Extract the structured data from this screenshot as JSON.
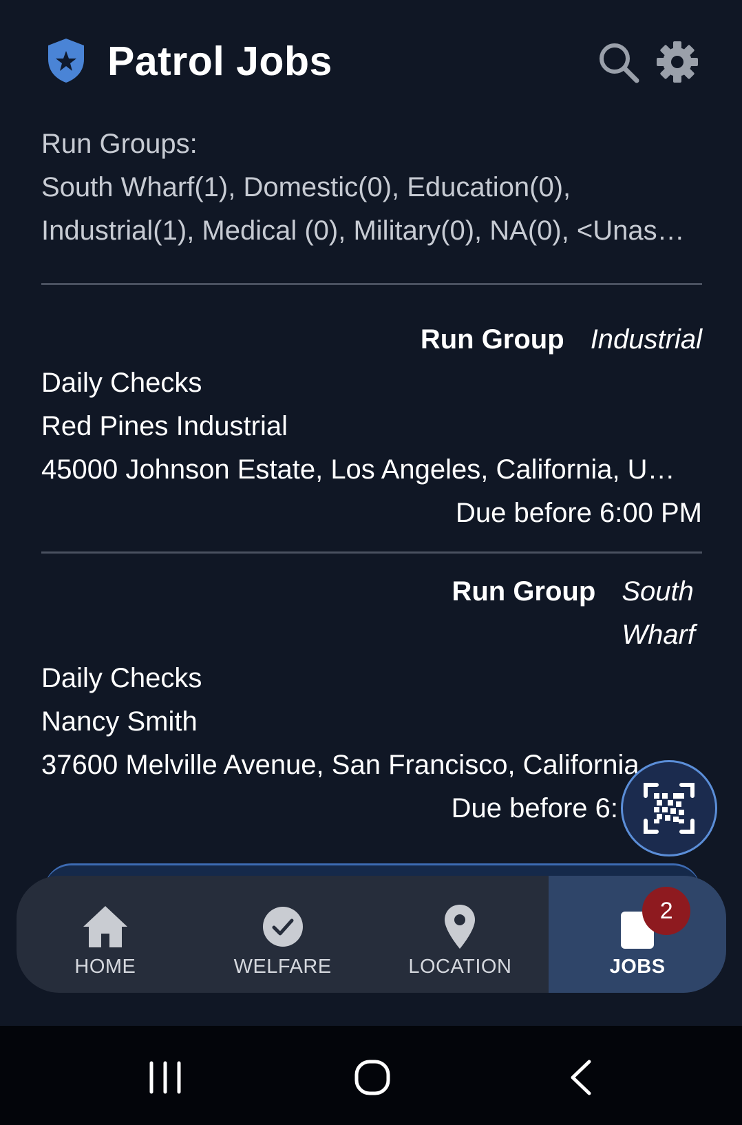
{
  "header": {
    "title": "Patrol Jobs",
    "logo_icon": "shield-star-icon",
    "actions": [
      {
        "icon": "search-icon"
      },
      {
        "icon": "gear-icon"
      }
    ]
  },
  "run_groups": {
    "label": "Run Groups:",
    "line1": "South Wharf(1), Domestic(0), Education(0),",
    "line2": "Industrial(1), Medical (0), Military(0), NA(0), <Unas…"
  },
  "jobs": [
    {
      "run_group_label": "Run Group",
      "run_group_value": "Industrial",
      "title": "Daily Checks",
      "site": "Red Pines Industrial",
      "address": "45000 Johnson Estate, Los Angeles, California, U…",
      "due": "Due before 6:00 PM"
    },
    {
      "run_group_label": "Run Group",
      "run_group_value_line1": "South",
      "run_group_value_line2": "Wharf",
      "title": "Daily Checks",
      "site": "Nancy Smith",
      "address": "37600 Melville Avenue, San Francisco, California",
      "due": "Due before 6:"
    }
  ],
  "fab": {
    "icon": "qr-scan-icon"
  },
  "bottom_nav": {
    "items": [
      {
        "label": "HOME",
        "icon": "home-icon"
      },
      {
        "label": "WELFARE",
        "icon": "check-circle-icon"
      },
      {
        "label": "LOCATION",
        "icon": "location-pin-icon"
      },
      {
        "label": "JOBS",
        "icon": "jobs-icon",
        "active": true,
        "badge": "2"
      }
    ]
  },
  "colors": {
    "background": "#101725",
    "accent": "#5b8ed8",
    "active_tab": "#2f4569",
    "badge": "#8e1a1f"
  }
}
